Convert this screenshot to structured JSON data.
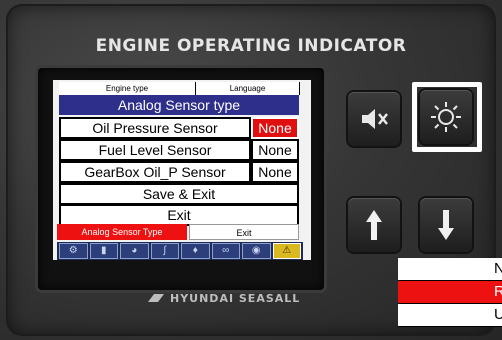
{
  "device": {
    "title": "ENGINE OPERATING INDICATOR",
    "brand": "HYUNDAI SEASALL"
  },
  "screen": {
    "header": {
      "left": "Engine type",
      "right": "Language"
    },
    "menu_title": "Analog Sensor type",
    "rows": [
      {
        "label": "Oil Pressure Sensor",
        "value": "None",
        "selected": true
      },
      {
        "label": "Fuel Level Sensor",
        "value": "None",
        "selected": false
      },
      {
        "label": "GearBox Oil_P Sensor",
        "value": "None",
        "selected": false
      }
    ],
    "save_exit": "Save & Exit",
    "exit": "Exit",
    "footer": {
      "left": "Analog Sensor Type",
      "right": "Exit"
    },
    "icons": [
      "engine-icon",
      "battery-icon",
      "gauge-icon",
      "temperature-icon",
      "oil-icon",
      "rpm-icon",
      "fuel-icon",
      "warning-icon"
    ]
  },
  "buttons": {
    "mute": "mute-icon",
    "light": "light-icon",
    "up": "arrow-up-icon",
    "down": "arrow-down-icon"
  },
  "dropdown": {
    "items": [
      "None",
      "Resistive",
      "Un"
    ],
    "selected": "Resistive"
  },
  "colors": {
    "title_bar": "#2e2f8a",
    "selected_red": "#ee1111",
    "icon_active": "#d9b820"
  }
}
